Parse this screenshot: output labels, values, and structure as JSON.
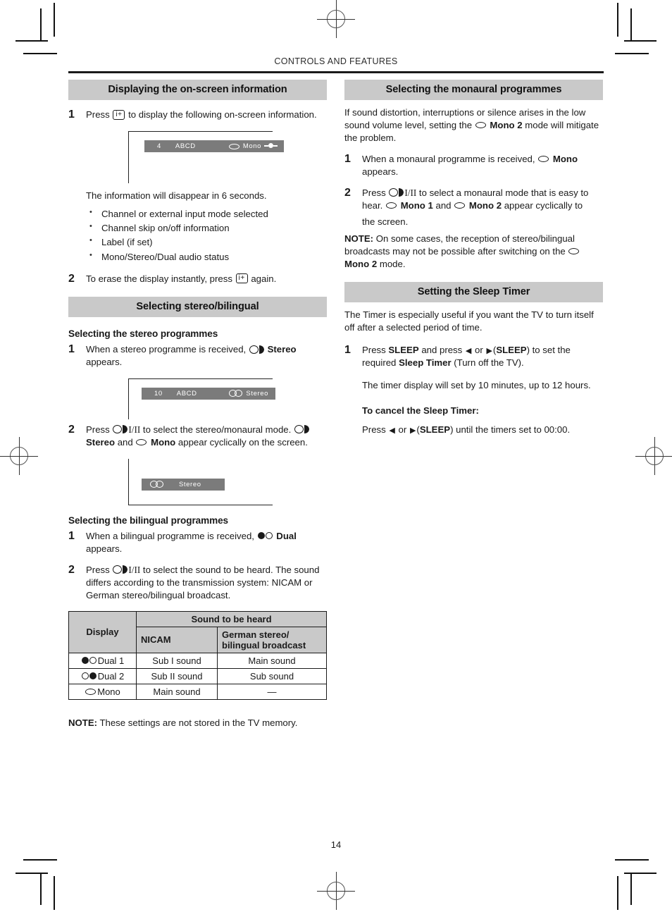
{
  "running_head": "CONTROLS AND FEATURES",
  "page_number": "14",
  "colors": {
    "section_bar_bg": "#c9c9c9",
    "osd_bar_bg": "#7b7b7b",
    "rule": "#1a1a1a"
  },
  "left_column": {
    "section1": {
      "heading": "Displaying the on-screen information",
      "step1_num": "1",
      "step1_text_before": "Press",
      "step1_key": "i+",
      "step1_text_after": "to display the following on-screen information.",
      "osd": {
        "channel": "4",
        "label": "ABCD",
        "mode": "Mono",
        "icon": "mono-icon",
        "extra_icon": "skip-icon"
      },
      "after_fig": "The information will disappear in 6 seconds.",
      "bullets": [
        "Channel or external input mode selected",
        "Channel skip on/off information",
        "Label (if set)",
        "Mono/Stereo/Dual audio status"
      ],
      "step2_num": "2",
      "step2_text_before": "To erase the display instantly, press",
      "step2_key": "i+",
      "step2_text_after": "again."
    },
    "section2": {
      "heading": "Selecting stereo/bilingual",
      "sub1": "Selecting the stereo programmes",
      "s1_step1_num": "1",
      "s1_step1_a": "When a stereo programme is received,",
      "s1_step1_icon": "stereo-icon",
      "s1_step1_bold": "Stereo",
      "s1_step1_b": "appears.",
      "osd1": {
        "channel": "10",
        "label": "ABCD",
        "mode": "Stereo",
        "icon": "stereo-icon"
      },
      "s1_step2_num": "2",
      "s1_step2_a": "Press",
      "s1_step2_key": "I/II",
      "s1_step2_b": "to select the stereo/monaural mode.",
      "s1_step2_icon1": "stereo-icon",
      "s1_step2_bold1": "Stereo",
      "s1_step2_c": "and",
      "s1_step2_icon2": "mono-icon",
      "s1_step2_bold2": "Mono",
      "s1_step2_d": "appear cyclically on the screen.",
      "osd2": {
        "mode": "Stereo",
        "icon": "stereo-icon"
      },
      "sub2": "Selecting the bilingual programmes",
      "s2_step1_num": "1",
      "s2_step1_a": "When a bilingual programme is received,",
      "s2_step1_icon": "dual-icon",
      "s2_step1_bold": "Dual",
      "s2_step1_b": "appears.",
      "s2_step2_num": "2",
      "s2_step2_a": "Press",
      "s2_step2_key": "I/II",
      "s2_step2_b": "to select the sound to be heard. The sound differs according to the transmission system: NICAM or German stereo/bilingual broadcast."
    },
    "table": {
      "header_display": "Display",
      "header_group": "Sound to be heard",
      "header_nicam": "NICAM",
      "header_german_line1": "German stereo/",
      "header_german_line2": "bilingual broadcast",
      "rows": [
        {
          "display": "Dual 1",
          "display_icon": "dual1-icon",
          "nicam": "Sub I sound",
          "german": "Main sound"
        },
        {
          "display": "Dual 2",
          "display_icon": "dual2-icon",
          "nicam": "Sub II sound",
          "german": "Sub sound"
        },
        {
          "display": "Mono",
          "display_icon": "mono-icon",
          "nicam": "Main sound",
          "german": "—"
        }
      ]
    },
    "note_bold": "NOTE:",
    "note_text": " These settings are not stored in the TV memory."
  },
  "right_column": {
    "section1": {
      "heading": "Selecting the monaural programmes",
      "intro_a": "If sound distortion, interruptions or silence arises in the low sound volume level, setting the",
      "intro_icon": "mono-icon",
      "intro_bold": "Mono 2",
      "intro_b": "mode will mitigate the problem.",
      "step1_num": "1",
      "step1_a": "When a monaural programme is received,",
      "step1_icon": "mono-icon",
      "step1_bold": "Mono",
      "step1_b": "appears.",
      "step2_num": "2",
      "step2_a": "Press",
      "step2_key": "I/II",
      "step2_b": "to select a monaural mode that is easy to hear.",
      "step2_icon1": "mono-icon",
      "step2_bold1": "Mono 1",
      "step2_c": "and",
      "step2_icon2": "mono-icon",
      "step2_bold2": "Mono 2",
      "step2_d": "appear cyclically to",
      "step2_e": "the screen.",
      "note_bold": "NOTE:",
      "note_a": " On some cases, the reception of stereo/bilingual broadcasts may not be possible after switching on the",
      "note_icon": "mono-icon",
      "note_bold2": "Mono 2",
      "note_b": "mode."
    },
    "section2": {
      "heading": "Setting the Sleep Timer",
      "intro": "The Timer is especially useful if you want the TV to turn itself off after a selected period of time.",
      "step1_num": "1",
      "step1_a": "Press",
      "step1_b1": "SLEEP",
      "step1_c": "and press",
      "step1_left": "◀",
      "step1_or": "or",
      "step1_right": "▶",
      "step1_paren1": "(",
      "step1_b2": "SLEEP",
      "step1_paren2": ") to set the required",
      "step1_b3": "Sleep Timer",
      "step1_d": "(Turn off the TV).",
      "sub_para": "The timer display will set by 10 minutes, up to 12 hours.",
      "cancel_head": "To cancel the Sleep Timer:",
      "cancel_a": "Press",
      "cancel_left": "◀",
      "cancel_or": "or",
      "cancel_right": "▶",
      "cancel_p1": "(",
      "cancel_b": "SLEEP",
      "cancel_p2": ") until the timers set to 00:00."
    }
  }
}
